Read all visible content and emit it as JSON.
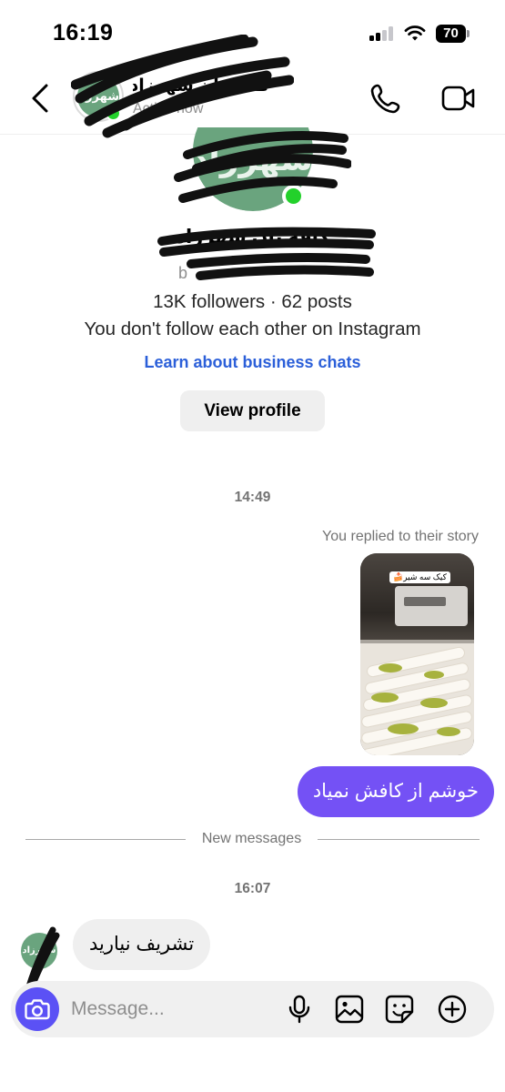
{
  "status_bar": {
    "time": "16:19",
    "battery_level": "70"
  },
  "header": {
    "contact_name": "کافه نان شهرزاد",
    "active_status": "Active now",
    "avatar_text": "شهرزاد"
  },
  "profile": {
    "avatar_text": "شهرزاد",
    "name": "کافه نان شهرزاد",
    "username": "b",
    "stats": "13K followers · 62 posts",
    "follow_note": "You don't follow each other on Instagram",
    "learn_link": "Learn about business chats",
    "view_profile_label": "View profile"
  },
  "conversation": {
    "first_time": "14:49",
    "replied_label": "You replied to their story",
    "story_sticker": "کیک سه شیر🍰",
    "outgoing_message": "خوشم از کافش نمیاد",
    "new_messages_label": "New messages",
    "second_time": "16:07",
    "incoming_message": "تشریف نیارید",
    "sender_avatar_text": "شهرزاد"
  },
  "composer": {
    "placeholder": "Message..."
  },
  "colors": {
    "accent": "#7451f5",
    "camera_button": "#5b51f5",
    "link": "#2b5fd9",
    "online": "#23d12b",
    "brand_avatar": "#6aa47e"
  },
  "icons": {
    "back": "chevron-left-icon",
    "call": "phone-icon",
    "video": "video-camera-icon",
    "camera": "camera-icon",
    "mic": "microphone-icon",
    "gallery": "image-icon",
    "sticker": "sticker-icon",
    "add": "plus-circle-icon"
  }
}
